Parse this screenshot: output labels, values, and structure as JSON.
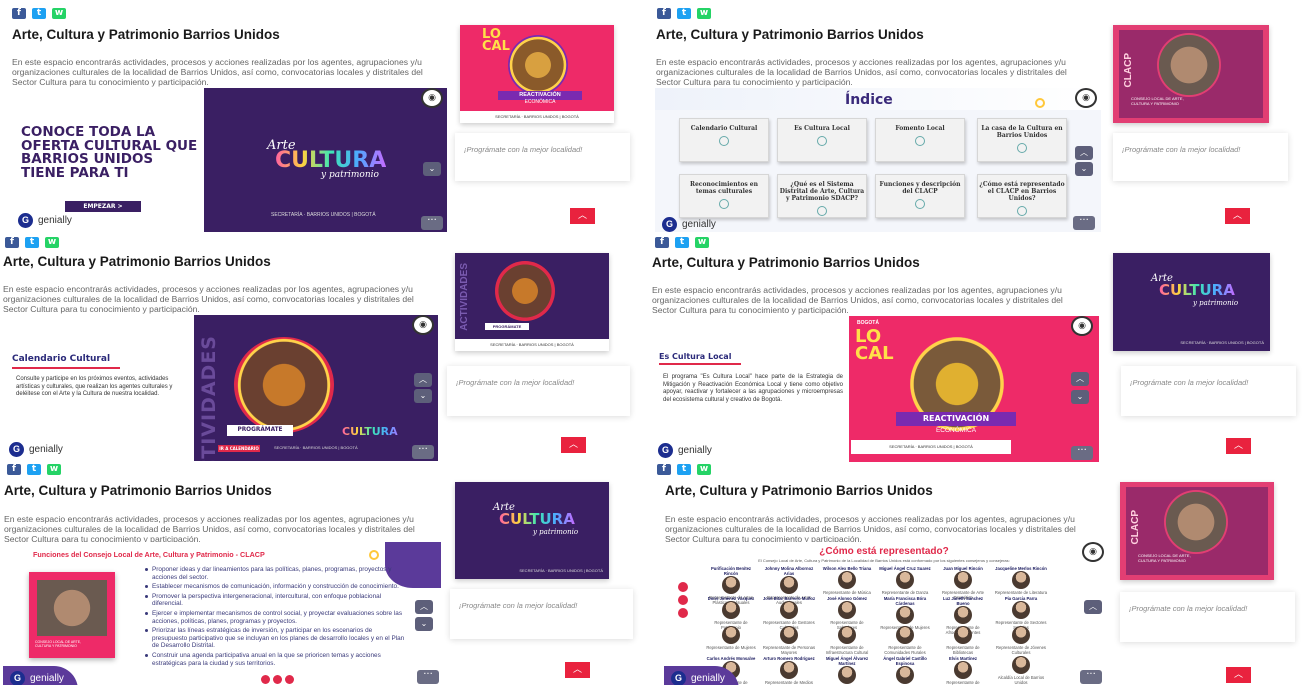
{
  "common": {
    "title": "Arte, Cultura y Patrimonio Barrios Unidos",
    "description": "En este espacio encontrarás actividades, procesos y acciones realizadas por los agentes, agrupaciones y/u organizaciones culturales de la localidad de Barrios Unidos, así como, convocatorias locales y distritales del Sector Cultura para tu conocimiento y participación.",
    "promo_text": "¡Prográmate con la mejor localidad!",
    "genially_label": "genially",
    "social": {
      "facebook": "f",
      "twitter": "t",
      "whatsapp": "w"
    },
    "footer_logos": "SECRETARÍA · BARRIOS UNIDOS | BOGOTÁ"
  },
  "panel1": {
    "headline": "CONOCE TODA LA OFERTA CULTURAL QUE BARRIOS UNIDOS TIENE PARA TI",
    "button": "EMPEZAR >",
    "brand_top": "Arte",
    "brand_main": "CULTURA",
    "brand_bottom": "y patrimonio",
    "thumb_badge": "LO CAL",
    "thumb_banner_1": "REACTIVACIÓN",
    "thumb_banner_2": "ECONÓMICA"
  },
  "panel2": {
    "index_title": "Índice",
    "cards": [
      "Calendario Cultural",
      "Es Cultura Local",
      "Fomento Local",
      "La casa de la Cultura en Barrios Unidos",
      "Reconocimientos en temas culturales",
      "¿Qué es el Sistema Distrital de Arte, Cultura y Patrimonio SDACP?",
      "Funciones y descripción del CLACP",
      "¿Cómo está representado el CLACP en Barrios Unidos?"
    ],
    "thumb_label": "CLACP",
    "thumb_caption": "CONSEJO LOCAL DE ARTE, CULTURA Y PATRIMONIO"
  },
  "panel3": {
    "section_title": "Calendario Cultural",
    "section_text": "Consulte y participe en los próximos eventos, actividades artísticas y culturales, que realizan los agentes culturales y deléitese con el Arte y la Cultura de nuestra localidad.",
    "vertical_word": "ACTIVIDADES",
    "button": "PROGRÁMATE",
    "calendar_label": "IR A CALENDARIO"
  },
  "panel4": {
    "section_title": "Es Cultura Local",
    "section_text": "El programa \"Es Cultura Local\" hace parte de la Estrategia de Mitigación y Reactivación Económica Local y tiene como objetivo apoyar, reactivar y fortalecer a las agrupaciones y microempresas del ecosistema cultural y creativo de Bogotá.",
    "badge_top": "BOGOTÁ",
    "badge": "LO CAL",
    "banner_1": "REACTIVACIÓN",
    "banner_2": "ECONÓMICA"
  },
  "panel5": {
    "section_title": "Funciones del Consejo Local de Arte, Cultura y Patrimonio - CLACP",
    "bullets": [
      "Proponer ideas y dar lineamientos para las políticas, planes, programas, proyectos y acciones del sector.",
      "Establecer mecanismos de comunicación, información y construcción de conocimiento.",
      "Promover la perspectiva intergeneracional, intercultural, con enfoque poblacional diferencial.",
      "Ejercer e implementar mecanismos de control social, y proyectar evaluaciones sobre las acciones, políticas, planes, programas y proyectos.",
      "Priorizar las líneas estratégicas de inversión, y participar en los escenarios de presupuesto participativo que se incluyan en los planes de desarrollo locales y en el Plan de Desarrollo Distrital.",
      "Construir una agenda participativa anual en la que se prioricen temas y acciones estratégicas para la ciudad y sus territorios."
    ]
  },
  "panel6": {
    "section_title": "¿Cómo está representado?",
    "intro": "El Consejo Local de Arte, Cultura y Patrimonio de la Localidad de Barrios Unidos está conformado por los siguientes consejeros y consejeras:",
    "members": [
      {
        "name": "Purificación Benítez Rincón",
        "role": "Representante de Artes Plásticas y Visuales"
      },
      {
        "name": "Johnny Molina Albornoz Arias",
        "role": "Representante de Artes Audiovisuales"
      },
      {
        "name": "Wilson Alex Bello Triana",
        "role": "Representante de Música"
      },
      {
        "name": "Miguel Ángel Cruz Suarez",
        "role": "Representante de Danza"
      },
      {
        "name": "Juan Miguel Rincón",
        "role": "Representante de Arte Dramático"
      },
      {
        "name": "Jacqueline Merlos Rincón",
        "role": "Representante de Literatura"
      },
      {
        "name": "Doris Jiménez Vásquez",
        "role": "Representante de Patrimonio"
      },
      {
        "name": "José Bitar Barreiro Muñoz",
        "role": "Representante de Gestores Culturales"
      },
      {
        "name": "José Alonso Gómez",
        "role": "Representante de Sabedores"
      },
      {
        "name": "María Francisca Bóra Cárdenas",
        "role": "Representante de Mujeres"
      },
      {
        "name": "Luz Janeth Sánchez Bueno",
        "role": "Representante de Afrodescendientes"
      },
      {
        "name": "Pia Garcia Parra",
        "role": "Representante de Sectores Sociales"
      },
      {
        "name": "",
        "role": "Representante de Mujeres"
      },
      {
        "name": "",
        "role": "Representante de Personas Mayores"
      },
      {
        "name": "",
        "role": "Representante de Infraestructura Cultural"
      },
      {
        "name": "",
        "role": "Representante de Comunidades Rurales"
      },
      {
        "name": "",
        "role": "Representante de Bibliotecas"
      },
      {
        "name": "",
        "role": "Representante de Jóvenes Culturales"
      },
      {
        "name": "Carlos Andrés Monsalve",
        "role": "Representante de Emprendimiento"
      },
      {
        "name": "Arturo Romero Rodríguez",
        "role": "Representante de Medios Locales"
      },
      {
        "name": "Miguel Ángel Álvarez Martínez",
        "role": "Representante de Cultura Festiva"
      },
      {
        "name": "Ángel Gabriel Castillo Espinosa",
        "role": "Representante de Circo"
      },
      {
        "name": "Elvis Martínez",
        "role": "Representante de Comunidades Étnicas"
      },
      {
        "name": "",
        "role": "Alcaldía Local de Barrios Unidos"
      }
    ]
  }
}
